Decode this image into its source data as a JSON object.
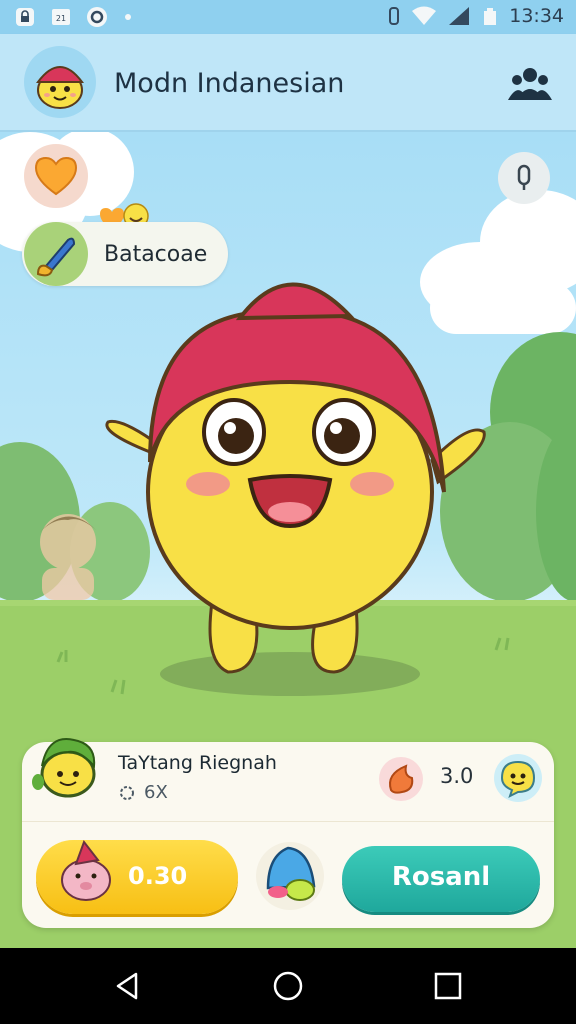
{
  "status_bar": {
    "time": "13:34",
    "left_icons": [
      "lock-icon",
      "calendar-icon",
      "circle-o-icon",
      "dot-icon"
    ],
    "right_icons": [
      "vibrate-icon",
      "wifi-icon",
      "signal-icon",
      "battery-icon"
    ]
  },
  "app": {
    "title": "Modn Indanesian",
    "people_icon": "people-icon"
  },
  "scene": {
    "heart_icon": "heart-icon",
    "mic_icon": "mic-icon",
    "tool_chip": {
      "label": "Batacoae",
      "icon": "paintbrush-icon"
    }
  },
  "panel": {
    "pet_name": "TaYtang Riegnah",
    "pet_meta": "6X",
    "stat_value": "3.0",
    "yellow_button": {
      "label": "0.30"
    },
    "teal_button": {
      "label": "Rosanl"
    }
  },
  "colors": {
    "sky": "#8fd0ef",
    "grass": "#9ccf68",
    "yellow": "#f7cf1c",
    "teal": "#2bb5a8",
    "hat": "#d8365a"
  }
}
